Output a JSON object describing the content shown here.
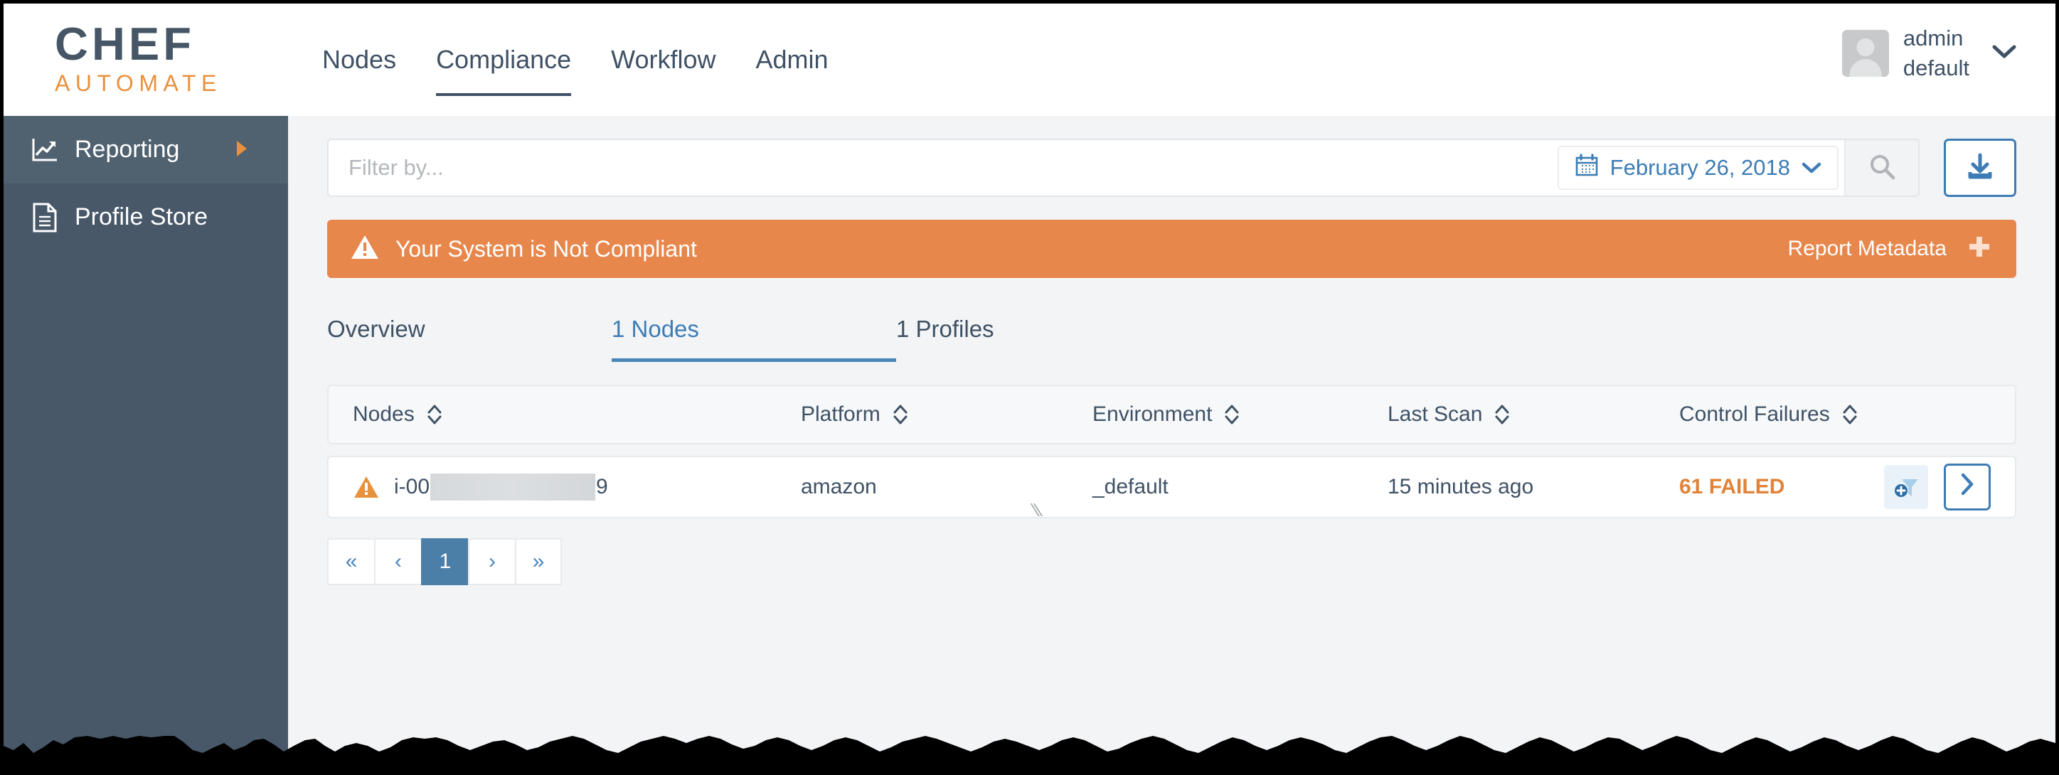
{
  "brand": {
    "name": "CHEF",
    "product": "AUTOMATE"
  },
  "nav": {
    "items": [
      {
        "label": "Nodes",
        "active": false
      },
      {
        "label": "Compliance",
        "active": true
      },
      {
        "label": "Workflow",
        "active": false
      },
      {
        "label": "Admin",
        "active": false
      }
    ]
  },
  "user": {
    "name": "admin",
    "org": "default",
    "chevron": "chevron-down"
  },
  "sidebar": {
    "items": [
      {
        "label": "Reporting",
        "icon": "chart-line-icon",
        "active": true,
        "expand_arrow": "▶"
      },
      {
        "label": "Profile Store",
        "icon": "document-icon",
        "active": false
      }
    ]
  },
  "search": {
    "placeholder": "Filter by...",
    "value": "",
    "date_label": "February 26, 2018",
    "calendar_icon": "calendar-icon",
    "search_icon": "search-icon",
    "export_icon": "download-icon"
  },
  "banner": {
    "icon": "warning-triangle-icon",
    "title": "Your System is Not Compliant",
    "metadata_label": "Report Metadata",
    "plus_icon": "plus-icon",
    "color": "#e8874c"
  },
  "tabs": [
    {
      "label": "Overview",
      "active": false
    },
    {
      "label": "1 Nodes",
      "active": true
    },
    {
      "label": "1 Profiles",
      "active": false
    }
  ],
  "table": {
    "columns": [
      {
        "label": "Nodes",
        "sortable": true
      },
      {
        "label": "Platform",
        "sortable": true
      },
      {
        "label": "Environment",
        "sortable": true
      },
      {
        "label": "Last Scan",
        "sortable": true
      },
      {
        "label": "Control Failures",
        "sortable": true
      }
    ],
    "rows": [
      {
        "status_icon": "warning-triangle-icon",
        "node_prefix": "i-00",
        "node_redacted": true,
        "node_suffix": "9",
        "platform": "amazon",
        "environment": "_default",
        "last_scan": "15 minutes ago",
        "control_failures": "61 FAILED",
        "failures_color": "#e08339",
        "add_filter_icon": "funnel-plus-icon",
        "detail_icon": "chevron-right-icon"
      }
    ]
  },
  "pagination": {
    "first": "«",
    "prev": "‹",
    "pages": [
      "1"
    ],
    "current": "1",
    "next": "›",
    "last": "»"
  },
  "colors": {
    "accent_orange": "#e8913c",
    "brand_slate": "#465666",
    "link_blue": "#3d7cb5",
    "sidebar_bg": "#485868",
    "page_bg": "#f2f4f6"
  }
}
